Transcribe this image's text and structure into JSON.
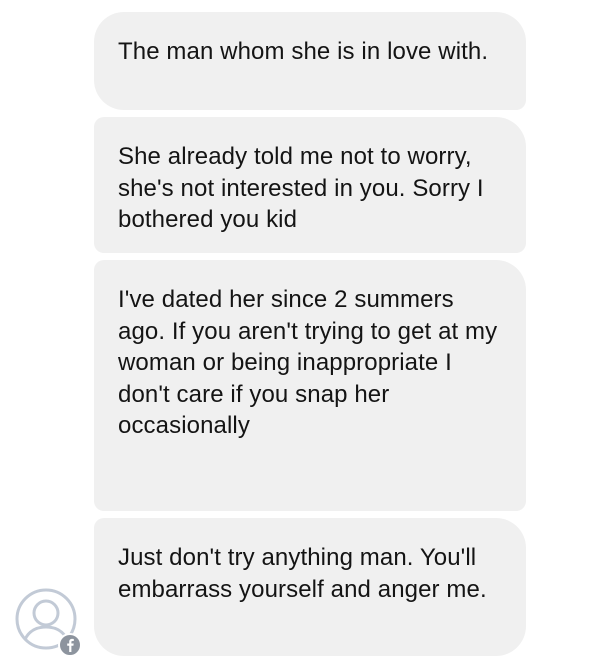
{
  "messages": [
    {
      "text": "The man whom she is in love with."
    },
    {
      "text": "She already told me not to worry, she's not interested in you. Sorry I bothered you kid"
    },
    {
      "text": "I've dated her since 2 summers ago. If you aren't trying to get at my woman or being inappropriate I don't care if you snap her occasionally"
    },
    {
      "text": "Just don't try anything man. You'll embarrass yourself and anger me."
    }
  ],
  "sender": {
    "avatar_icon": "default-profile-silhouette-icon",
    "badge_icon": "facebook-badge-icon"
  },
  "colors": {
    "bubble_background": "#f0f0f0",
    "text": "#141414",
    "avatar_outline": "#c2cad6",
    "facebook_badge": "#8d949e"
  }
}
